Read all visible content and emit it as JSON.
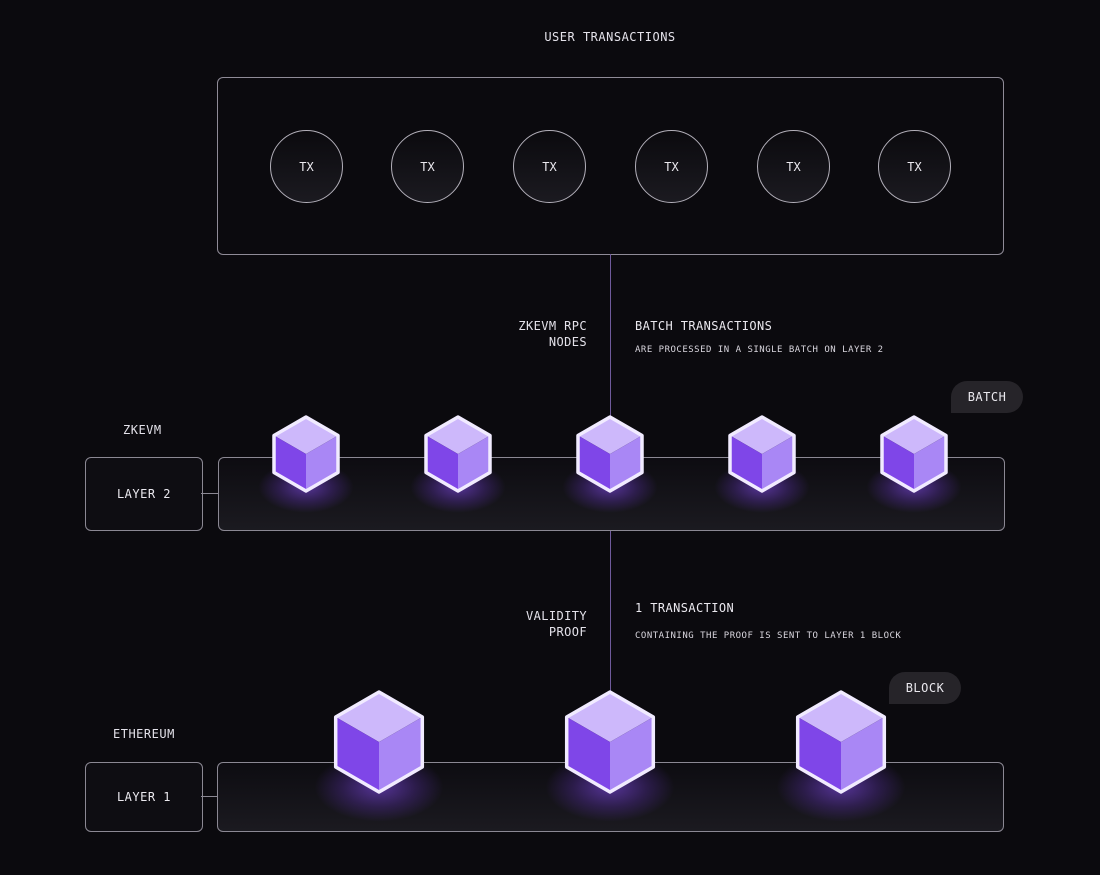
{
  "header": {
    "title": "USER TRANSACTIONS"
  },
  "transactions": [
    "TX",
    "TX",
    "TX",
    "TX",
    "TX",
    "TX"
  ],
  "rpc": {
    "left_lines": [
      "ZKEVM RPC",
      "NODES"
    ],
    "title": "BATCH TRANSACTIONS",
    "subtitle": "ARE PROCESSED IN A SINGLE BATCH ON LAYER 2"
  },
  "layer2": {
    "network": "ZKEVM",
    "label": "LAYER 2",
    "badge": "BATCH",
    "cube_count": 5
  },
  "proof": {
    "left_lines": [
      "VALIDITY",
      "PROOF"
    ],
    "title": "1 TRANSACTION",
    "subtitle": "CONTAINING THE PROOF IS SENT TO LAYER 1 BLOCK"
  },
  "layer1": {
    "network": "ETHEREUM",
    "label": "LAYER 1",
    "badge": "BLOCK",
    "cube_count": 3
  },
  "colors": {
    "background": "#0b0a0e",
    "cube_top": "#cdb8fb",
    "cube_left": "#7f46e8",
    "cube_right": "#a987f5",
    "cube_edge": "#f1ebff",
    "connector": "#6f5a9b"
  }
}
